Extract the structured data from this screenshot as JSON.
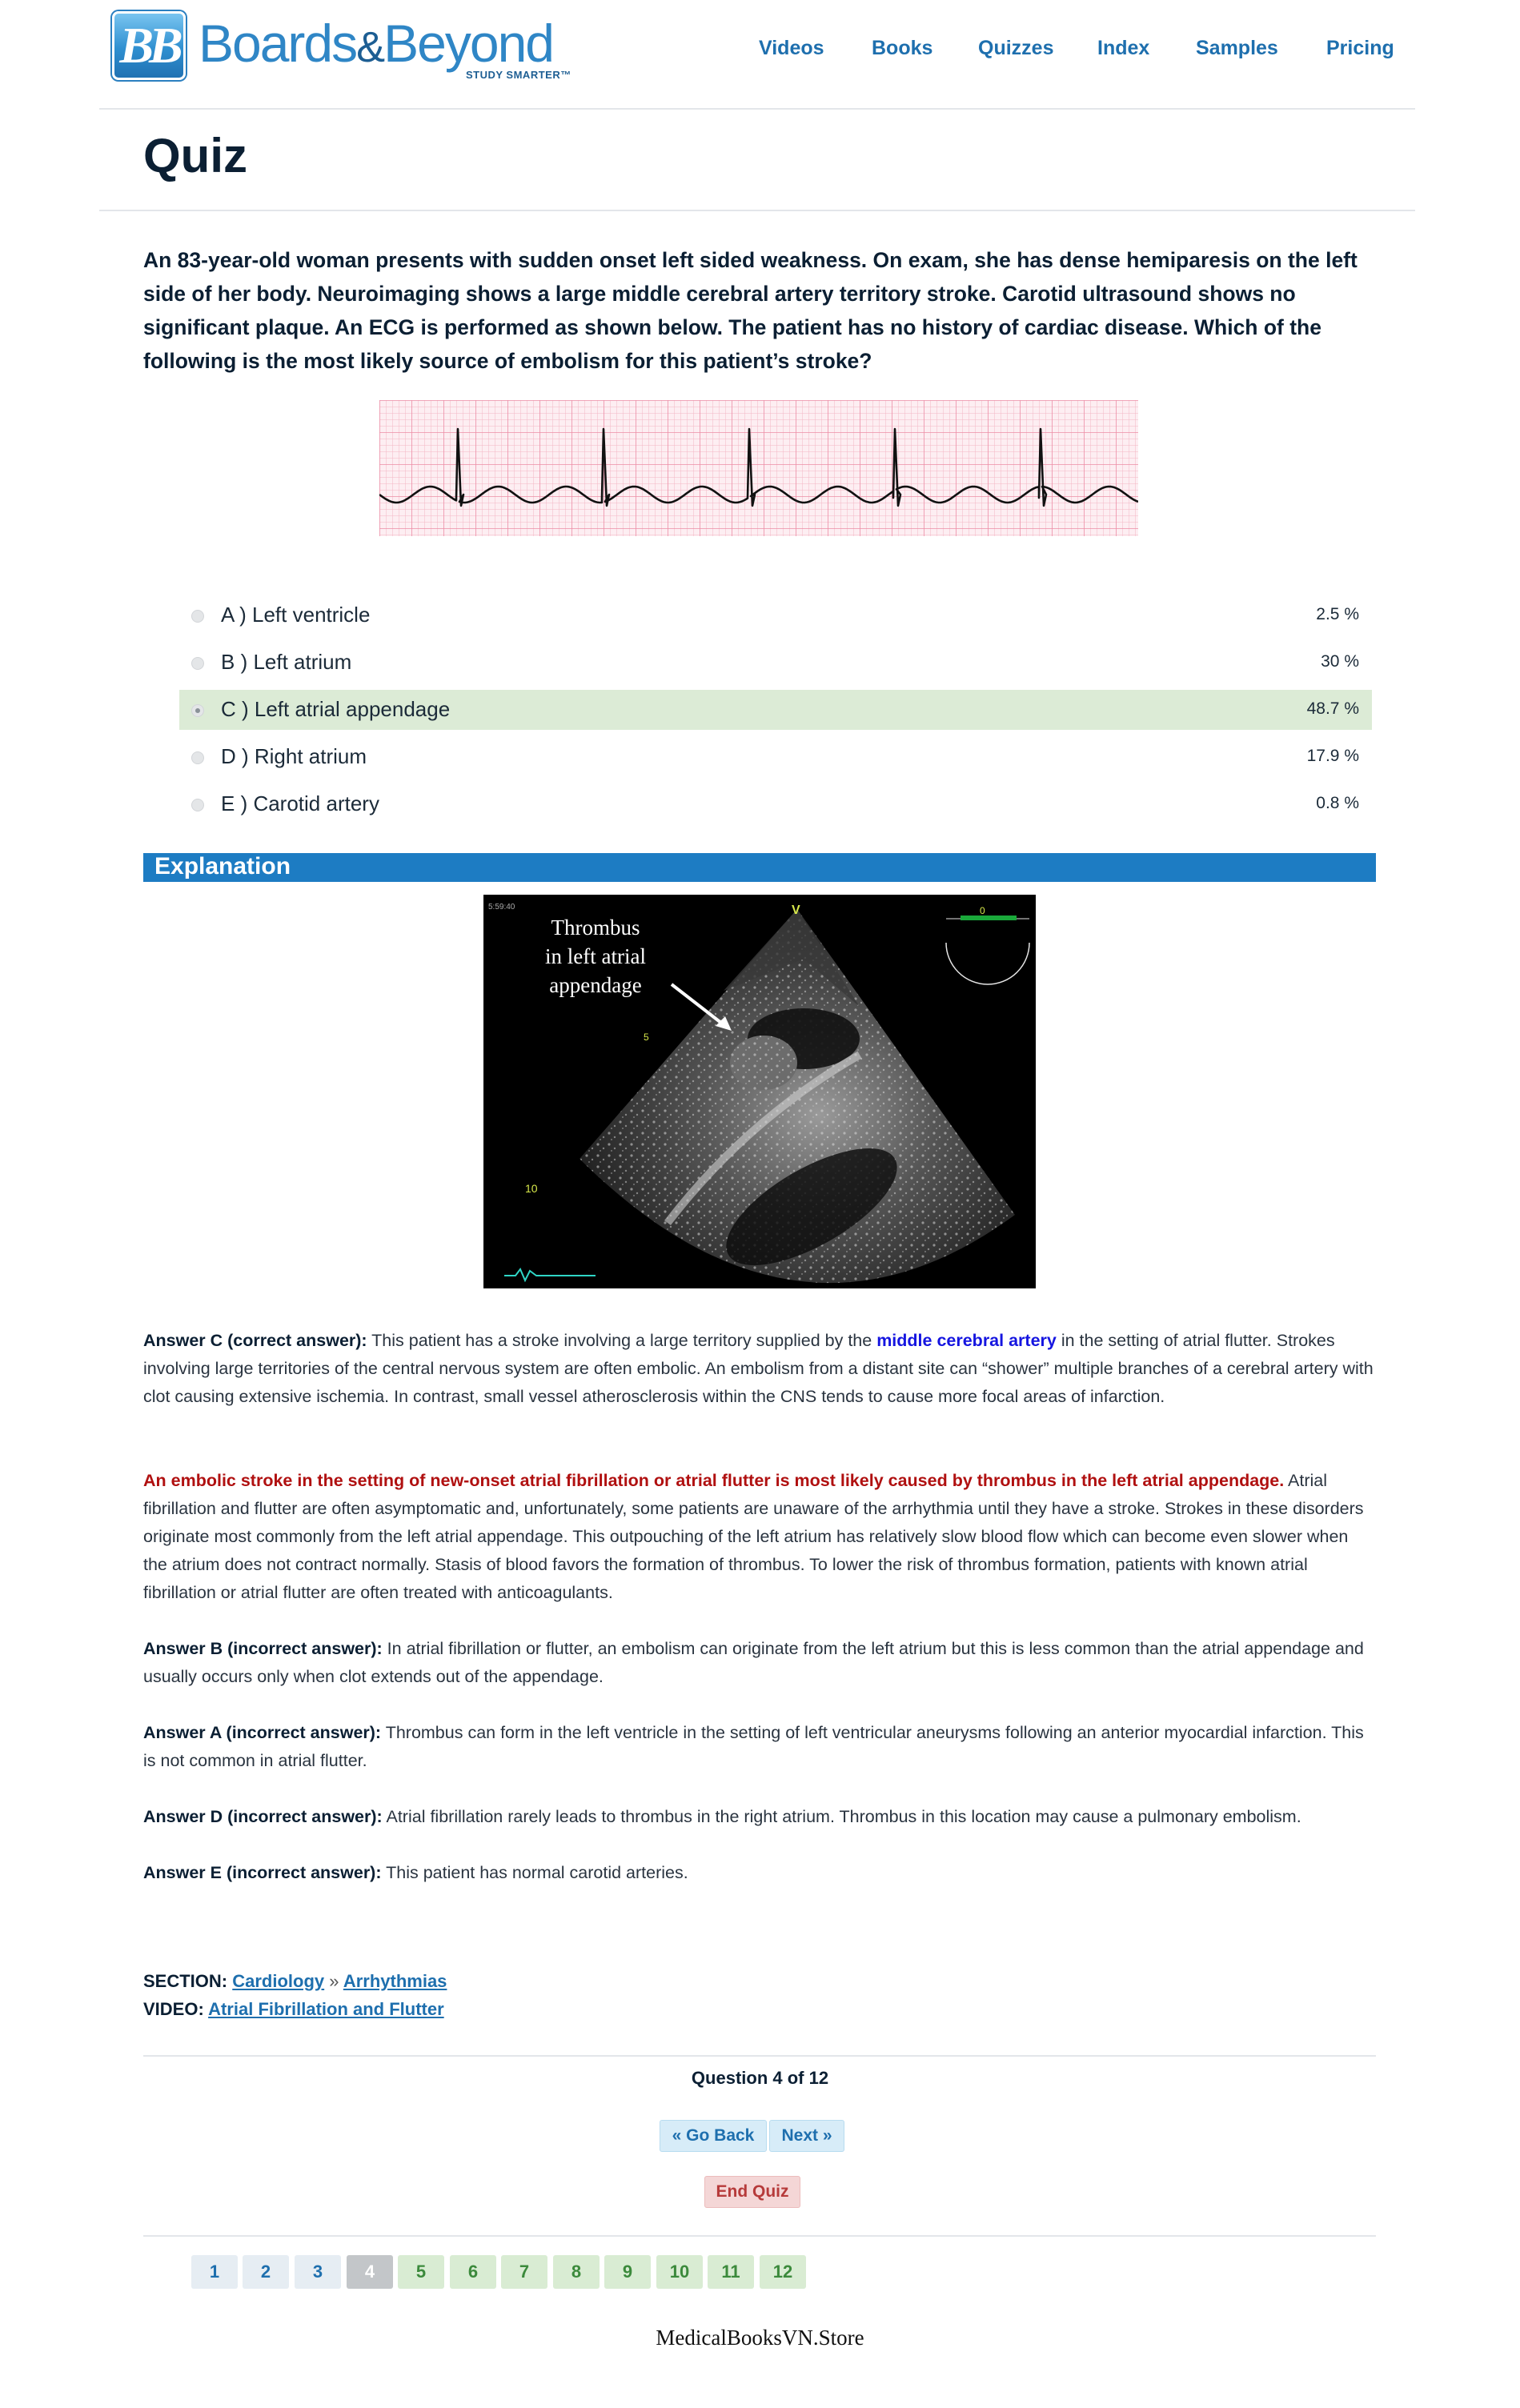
{
  "brand": {
    "badge": "BB",
    "name_part1": "Boards",
    "name_amp": "&",
    "name_part2": "Beyond",
    "tagline": "STUDY SMARTER™"
  },
  "nav": {
    "items": [
      {
        "label": "Videos"
      },
      {
        "label": "Books"
      },
      {
        "label": "Quizzes"
      },
      {
        "label": "Index"
      },
      {
        "label": "Samples"
      },
      {
        "label": "Pricing"
      }
    ]
  },
  "page_title": "Quiz",
  "question": "An 83-year-old woman presents with sudden onset left sided weakness. On exam, she has dense hemiparesis on the left side of her body. Neuroimaging shows a large middle cerebral artery territory stroke. Carotid ultrasound shows no significant plaque. An ECG is performed as shown below. The patient has no history of cardiac disease. Which of the following is the most likely source of embolism for this patient’s stroke?",
  "choices": [
    {
      "label": "A ) Left ventricle",
      "percent": "2.5 %"
    },
    {
      "label": "B ) Left atrium",
      "percent": "30 %"
    },
    {
      "label": "C ) Left atrial appendage",
      "percent": "48.7 %",
      "selected": true
    },
    {
      "label": "D ) Right atrium",
      "percent": "17.9 %"
    },
    {
      "label": "E ) Carotid artery",
      "percent": "0.8 %"
    }
  ],
  "explanation": {
    "heading": "Explanation",
    "image_caption": "Thrombus in left atrial appendage",
    "image_text": {
      "caption_line1": "Thrombus",
      "caption_line2": "in left atrial",
      "caption_line3": "appendage",
      "timestamp": "5:59:40",
      "marker_v": "V",
      "marker_0": "0",
      "marker_5": "5",
      "marker_10": "10"
    },
    "p1": {
      "lead": "Answer C (correct answer):",
      "text_a": " This patient has a stroke involving a large territory supplied by the ",
      "highlight": "middle cerebral artery",
      "text_b": " in the setting of atrial flutter. Strokes involving large territories of the central nervous system are often embolic. An embolism from a distant site can “shower” multiple branches of a cerebral artery with clot causing extensive ischemia. In contrast, small vessel atherosclerosis within the CNS tends to cause more focal areas of infarction."
    },
    "p2": {
      "highlight": "An embolic stroke in the setting of new-onset atrial fibrillation or atrial flutter is most likely caused by thrombus in the left atrial appendage.",
      "text": " Atrial fibrillation and flutter are often asymptomatic and, unfortunately, some patients are unaware of the arrhythmia until they have a stroke. Strokes in these disorders originate most commonly from the left atrial appendage. This outpouching of the left atrium has relatively slow blood flow which can become even slower when the atrium does not contract normally. Stasis of blood favors the formation of thrombus. To lower the risk of thrombus formation, patients with known atrial fibrillation or atrial flutter are often treated with anticoagulants."
    },
    "p3": {
      "lead": "Answer B (incorrect answer):",
      "text": " In atrial fibrillation or flutter, an embolism can originate from the left atrium but this is less common than the atrial appendage and usually occurs only when clot extends out of the appendage."
    },
    "p4": {
      "lead": "Answer A (incorrect answer):",
      "text": " Thrombus can form in the left ventricle in the setting of left ventricular aneurysms following an anterior myocardial infarction. This is not common in atrial flutter."
    },
    "p5": {
      "lead": "Answer D (incorrect answer):",
      "text": " Atrial fibrillation rarely leads to thrombus in the right atrium. Thrombus in this location may cause a pulmonary embolism."
    },
    "p6": {
      "lead": "Answer E (incorrect answer):",
      "text": " This patient has normal carotid arteries."
    }
  },
  "section": {
    "label": "SECTION:",
    "link1": "Cardiology",
    "separator": "»",
    "link2": "Arrhythmias"
  },
  "video": {
    "label": "VIDEO:",
    "link": "Atrial Fibrillation and Flutter"
  },
  "pager": {
    "question_count": "Question 4 of 12",
    "go_back": "« Go Back",
    "next": "Next »",
    "end_quiz": "End Quiz",
    "pages": [
      {
        "label": "1",
        "state": "visited"
      },
      {
        "label": "2",
        "state": "visited"
      },
      {
        "label": "3",
        "state": "visited"
      },
      {
        "label": "4",
        "state": "current"
      },
      {
        "label": "5",
        "state": "upcoming"
      },
      {
        "label": "6",
        "state": "upcoming"
      },
      {
        "label": "7",
        "state": "upcoming"
      },
      {
        "label": "8",
        "state": "upcoming"
      },
      {
        "label": "9",
        "state": "upcoming"
      },
      {
        "label": "10",
        "state": "upcoming"
      },
      {
        "label": "11",
        "state": "upcoming"
      },
      {
        "label": "12",
        "state": "upcoming"
      }
    ]
  },
  "footer_text": "MedicalBooksVN.Store",
  "colors": {
    "nav_link": "#1e6fae",
    "explanation_bar": "#1d7cc3",
    "selected_row": "#dcebd6",
    "highlight_blue": "#1515e0",
    "highlight_red": "#b01010"
  }
}
